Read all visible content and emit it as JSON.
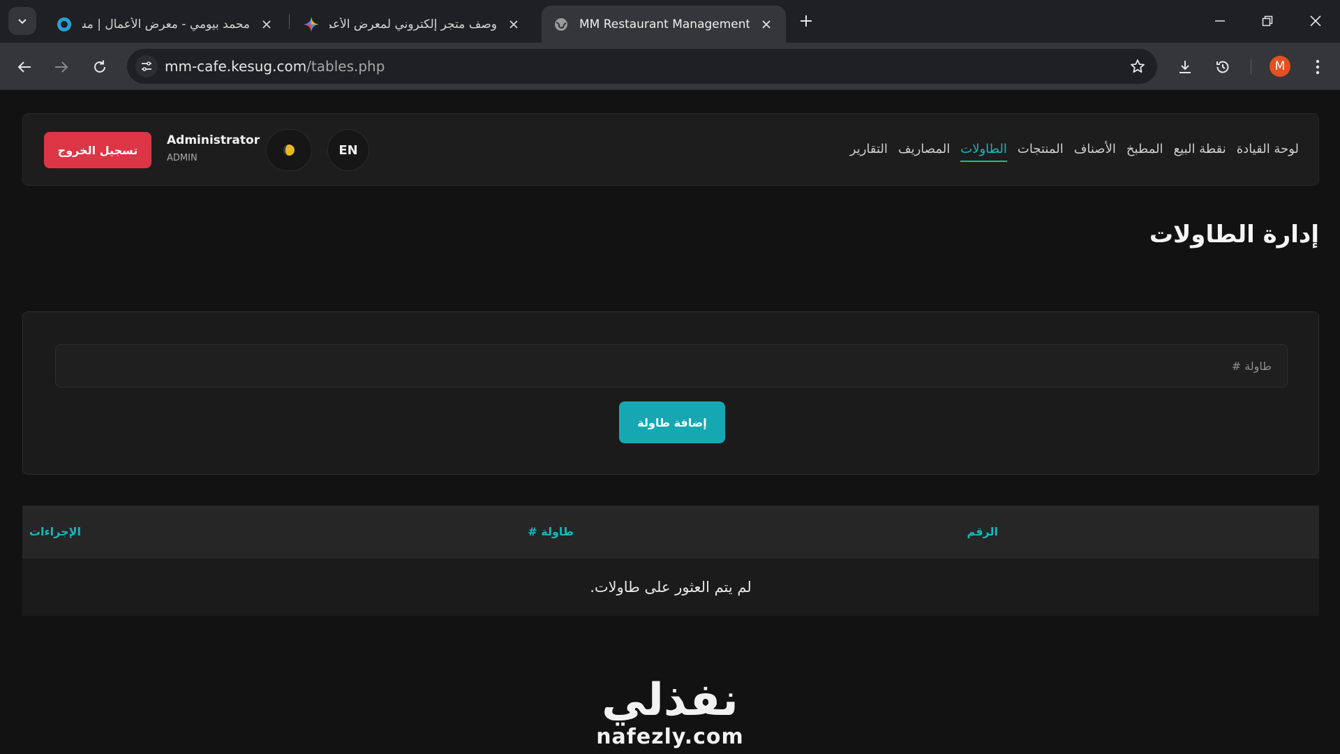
{
  "browser": {
    "tabs": [
      {
        "title": "محمد بيومي - معرض الأعمال | مستقل",
        "active": false
      },
      {
        "title": "وصف متجر إلكتروني لمعرض الأعمال",
        "active": false
      },
      {
        "title": "MM Restaurant Management",
        "active": true
      }
    ],
    "url_host": "mm-cafe.kesug.com",
    "url_path": "/tables.php",
    "profile_initial": "M",
    "colors": {
      "profile": "#e2511f",
      "accent": "#1ab5bf",
      "danger": "#dc3545"
    }
  },
  "navbar": {
    "links": [
      "لوحة القيادة",
      "نقطة البيع",
      "المطبخ",
      "الأصناف",
      "المنتجات",
      "الطاولات",
      "المصاريف",
      "التقارير"
    ],
    "active_index": 5,
    "lang_label": "EN",
    "theme_icon": "half-moon-icon",
    "user_name": "Administrator",
    "user_role": "ADMIN",
    "logout_label": "تسجيل الخروج"
  },
  "page": {
    "title": "إدارة الطاولات",
    "form": {
      "input_placeholder": "طاولة #",
      "input_value": "",
      "add_label": "إضافة طاولة"
    },
    "table": {
      "headers": [
        "الرقم",
        "طاولة #",
        "الإجراءات"
      ],
      "empty_message": "لم يتم العثور على طاولات."
    }
  },
  "watermark": {
    "arabic": "نفذلي",
    "latin": "nafezly.com"
  }
}
